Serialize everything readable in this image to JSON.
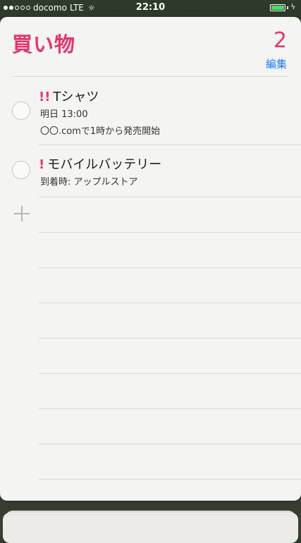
{
  "status_bar": {
    "carrier": "docomo",
    "network": "LTE",
    "activity": "☼",
    "time": "22:10",
    "battery_color": "#4cd964"
  },
  "list": {
    "title": "買い物",
    "count": "2",
    "edit_label": "編集",
    "accent_color": "#e8336a"
  },
  "items": [
    {
      "priority": "!!",
      "title": "Tシャツ",
      "subtitle1": "明日 13:00",
      "subtitle2": "〇〇.comで1時から発売開始"
    },
    {
      "priority": "!",
      "title": "モバイルバッテリー",
      "subtitle1": "到着時: アップルストア"
    }
  ]
}
